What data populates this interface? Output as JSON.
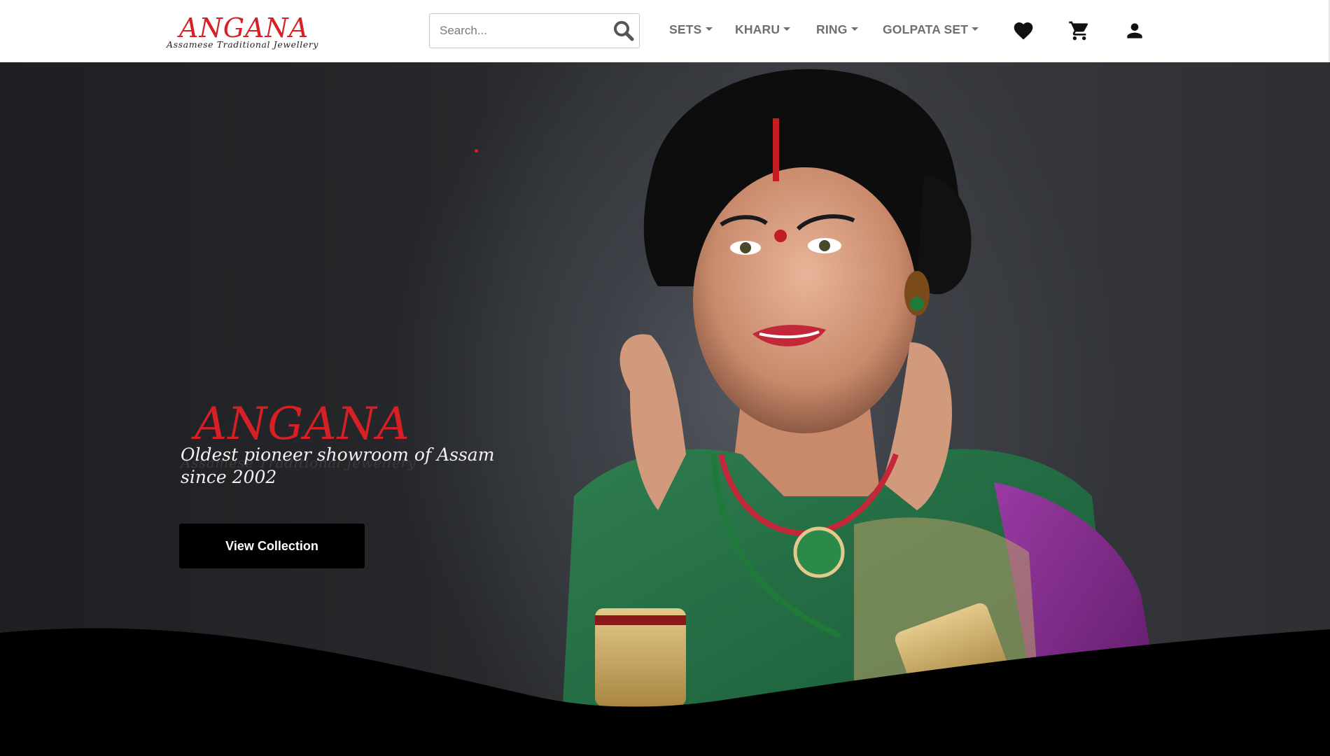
{
  "brand": {
    "name": "ANGANA",
    "tagline": "Assamese Traditional Jewellery"
  },
  "search": {
    "placeholder": "Search...",
    "value": ""
  },
  "nav": {
    "items": [
      {
        "label": "SETS"
      },
      {
        "label": "KHARU"
      },
      {
        "label": "RING"
      },
      {
        "label": "GOLPATA SET"
      }
    ]
  },
  "icons": {
    "search": "search-icon",
    "wishlist": "heart-icon",
    "cart": "cart-icon",
    "account": "user-icon"
  },
  "hero": {
    "logo_name": "ANGANA",
    "logo_sub": "Assamese Traditional Jewellery",
    "tagline_line1": "Oldest pioneer showroom of Assam",
    "tagline_line2": "since 2002",
    "cta_label": "View Collection"
  },
  "colors": {
    "brand_red": "#d71f26",
    "nav_text": "#6f6f6f",
    "button_bg": "#000000"
  }
}
